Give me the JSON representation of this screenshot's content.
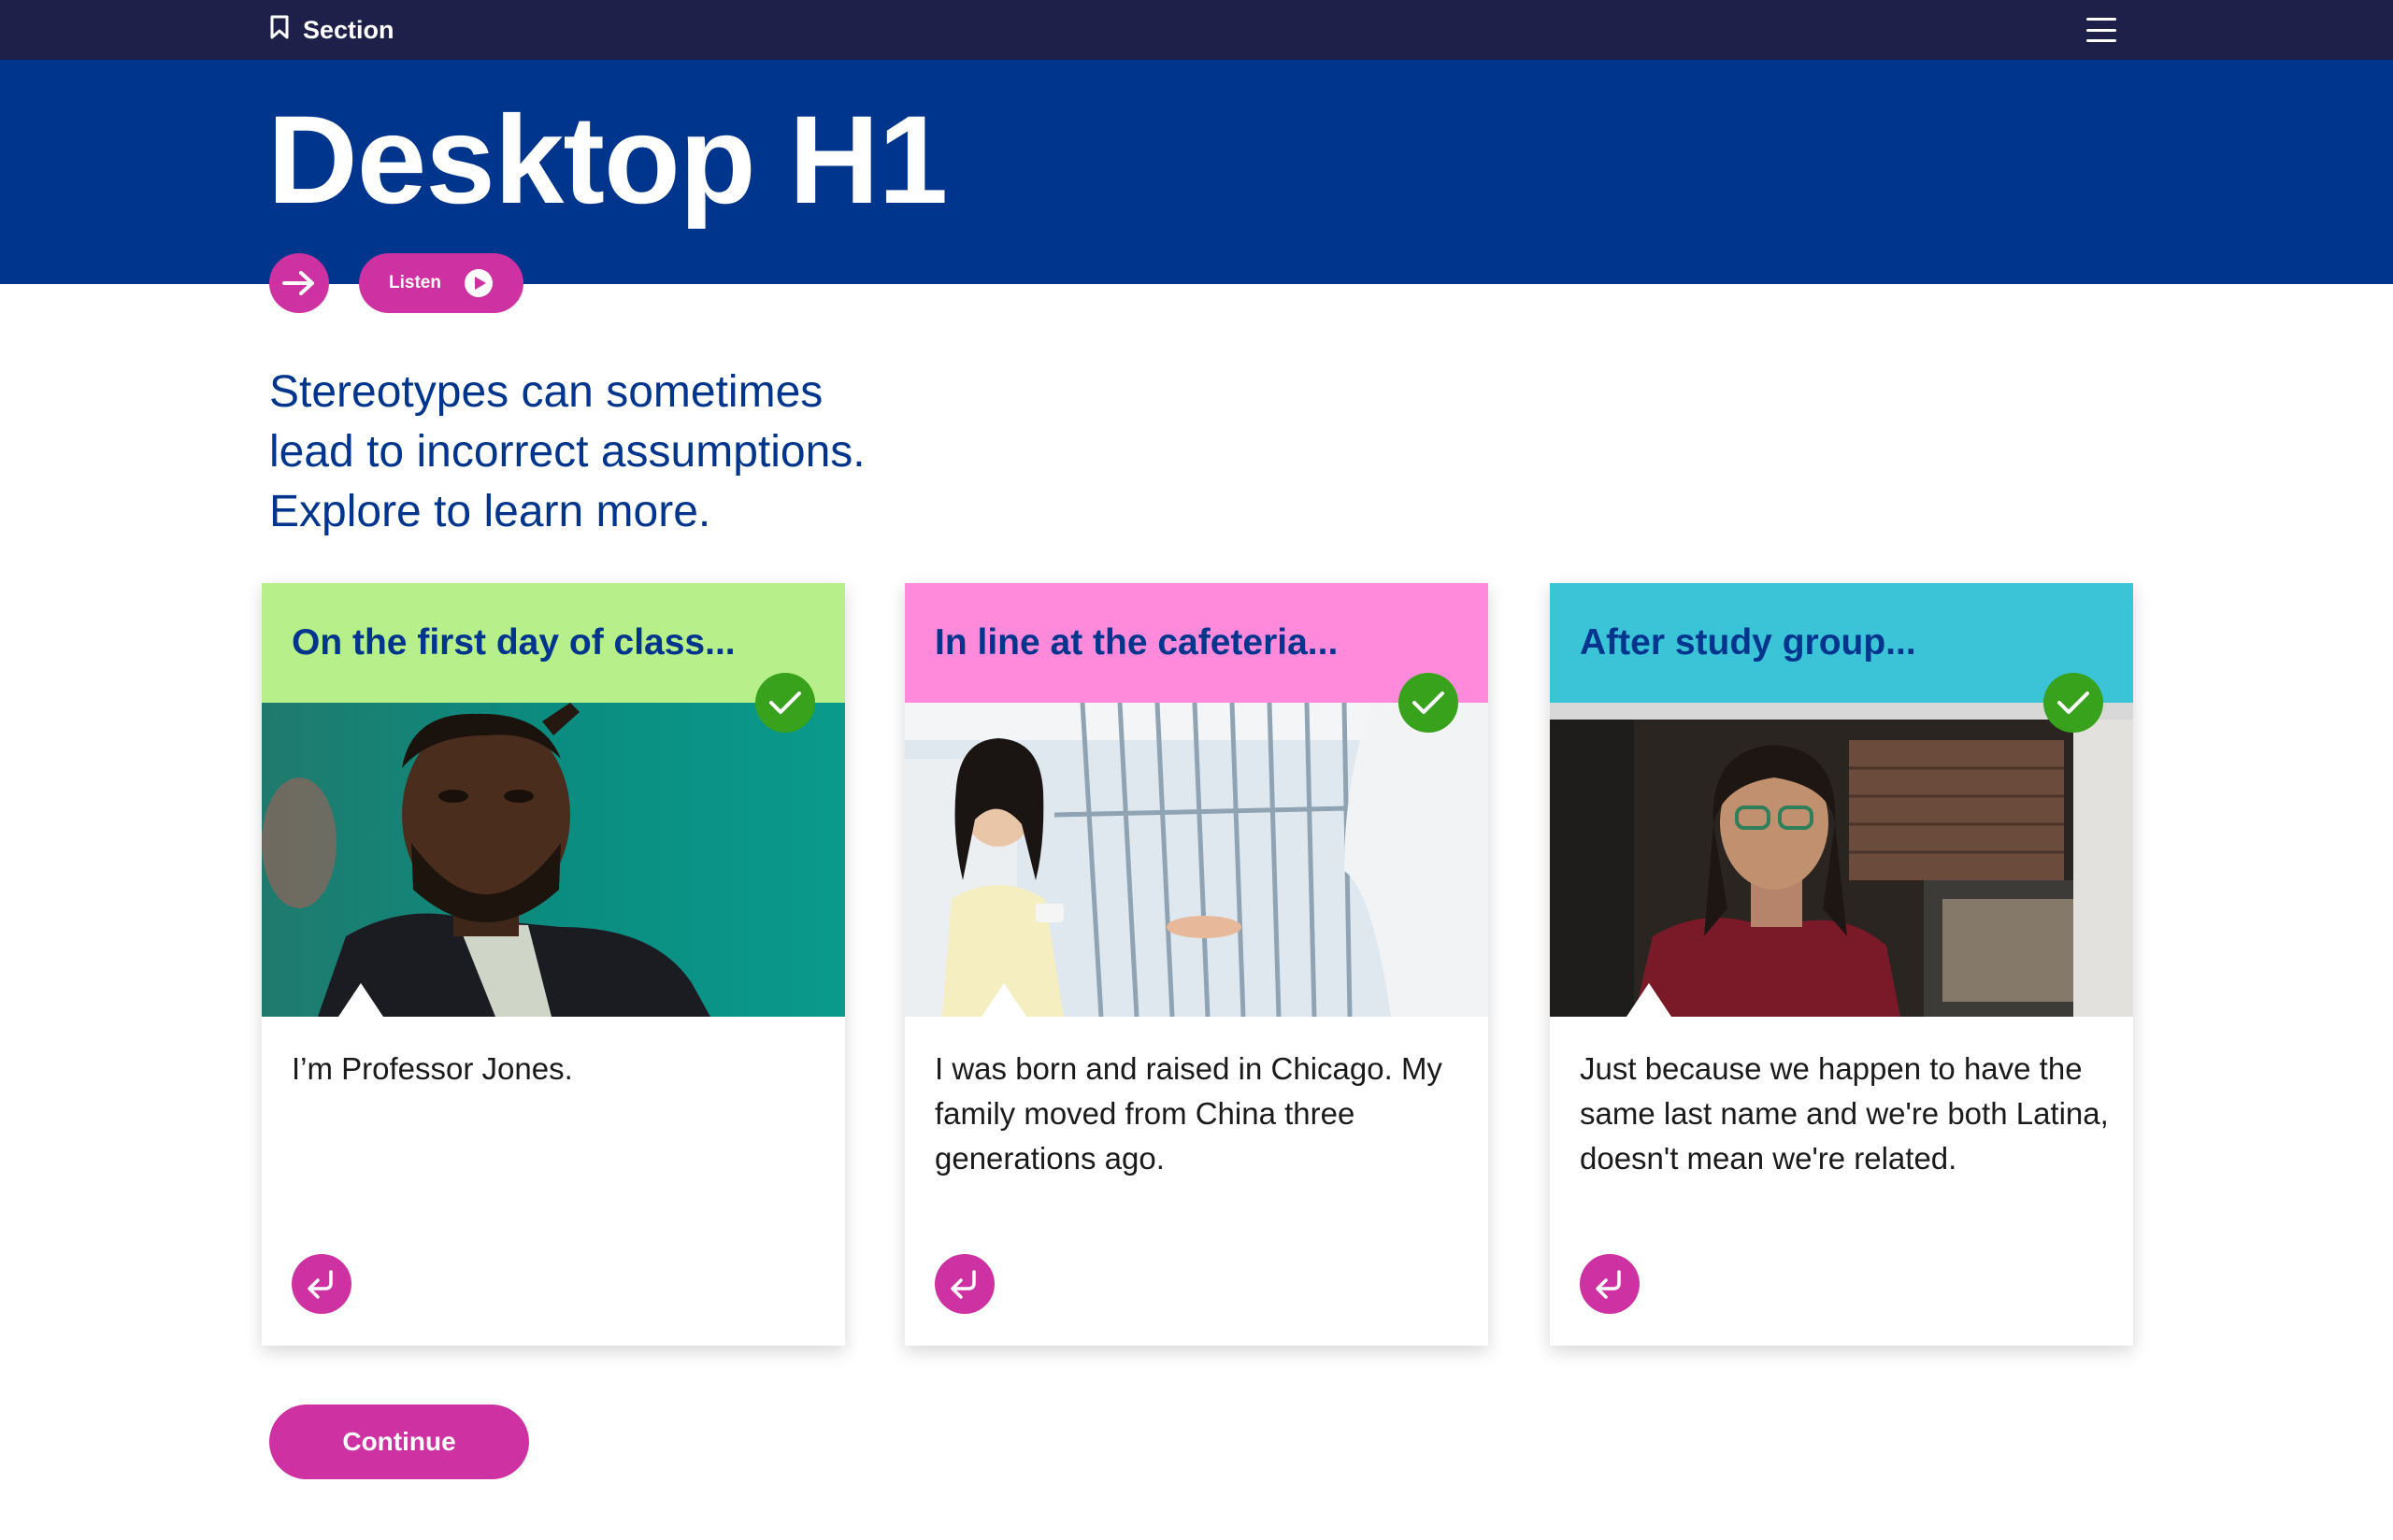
{
  "nav": {
    "section_label": "Section"
  },
  "hero": {
    "title": "Desktop H1"
  },
  "controls": {
    "listen_label": "Listen"
  },
  "intro": {
    "line1": "Stereotypes can sometimes",
    "line2": "lead to incorrect assumptions.",
    "line3": "Explore to learn more."
  },
  "cards": [
    {
      "title": "On the first day of class...",
      "text": "I’m Professor Jones.",
      "header_color": "#b7ef8b",
      "completed": true
    },
    {
      "title": "In line at the cafeteria...",
      "text": "I was born and raised in Chicago. My family moved from China three generations ago.",
      "header_color": "#ff8adb",
      "completed": true
    },
    {
      "title": "After study group...",
      "text": "Just because we happen to have the same last name and we're both Latina, doesn't mean we're related.",
      "header_color": "#3bc4d8",
      "completed": true
    }
  ],
  "actions": {
    "continue_label": "Continue"
  },
  "colors": {
    "nav_bg": "#1e2049",
    "hero_bg": "#00358e",
    "accent": "#ce31a1",
    "check": "#38a21c",
    "text_blue": "#00358e"
  }
}
